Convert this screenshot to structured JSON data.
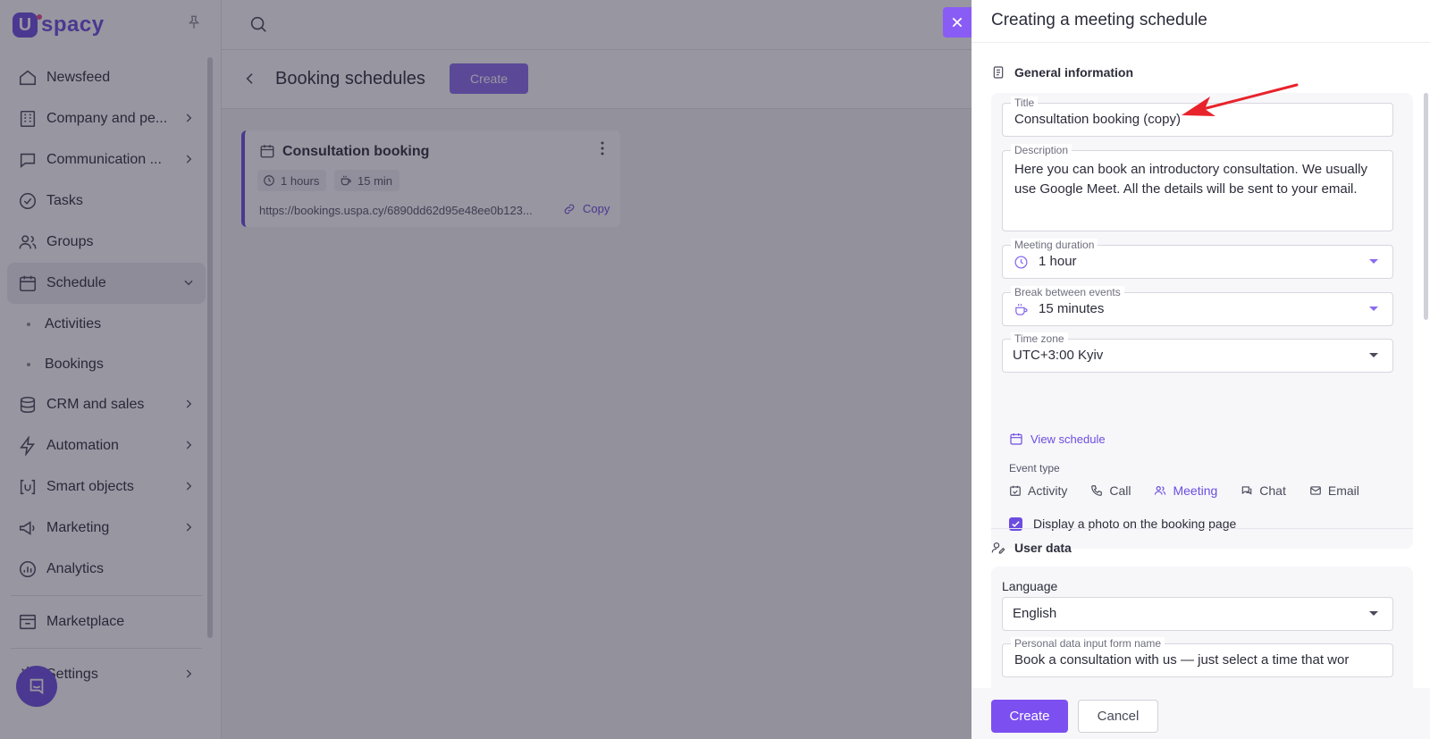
{
  "app": {
    "logo_letter": "U",
    "logo_text": "spacy",
    "nav": [
      {
        "label": "Newsfeed"
      },
      {
        "label": "Company and pe..."
      },
      {
        "label": "Communication ..."
      },
      {
        "label": "Tasks"
      },
      {
        "label": "Groups"
      },
      {
        "label": "Schedule"
      },
      {
        "label": "Activities"
      },
      {
        "label": "Bookings"
      },
      {
        "label": "CRM and sales"
      },
      {
        "label": "Automation"
      },
      {
        "label": "Smart objects"
      },
      {
        "label": "Marketing"
      },
      {
        "label": "Analytics"
      },
      {
        "label": "Marketplace"
      },
      {
        "label": "Settings"
      }
    ]
  },
  "page": {
    "title": "Booking schedules",
    "create_label": "Create",
    "card": {
      "title": "Consultation booking",
      "duration": "1 hours",
      "break": "15 min",
      "url": "https://bookings.uspa.cy/6890dd62d95e48ee0b123...",
      "copy_label": "Copy"
    }
  },
  "drawer": {
    "title": "Creating a meeting schedule",
    "general_heading": "General information",
    "title_field": {
      "label": "Title",
      "value": "Consultation booking (copy)"
    },
    "description_field": {
      "label": "Description",
      "value": "Here you can book an introductory consultation. We usually use Google Meet. All the details will be sent to your email."
    },
    "duration_field": {
      "label": "Meeting duration",
      "value": "1 hour"
    },
    "break_field": {
      "label": "Break between events",
      "value": "15 minutes"
    },
    "timezone_field": {
      "label": "Time zone",
      "value": "UTC+3:00 Kyiv"
    },
    "view_schedule": "View schedule",
    "event_type_label": "Event type",
    "event_types": [
      "Activity",
      "Call",
      "Meeting",
      "Chat",
      "Email"
    ],
    "selected_event_type": "Meeting",
    "display_photo": "Display a photo on the booking page",
    "user_heading": "User data",
    "language_label": "Language",
    "language_value": "English",
    "form_name_field": {
      "label": "Personal data input form name",
      "value": "Book a consultation with us — just select a time that wor"
    },
    "create_label": "Create",
    "cancel_label": "Cancel"
  },
  "colors": {
    "accent": "#6c4ce0",
    "annotation_arrow": "#e8232b"
  }
}
